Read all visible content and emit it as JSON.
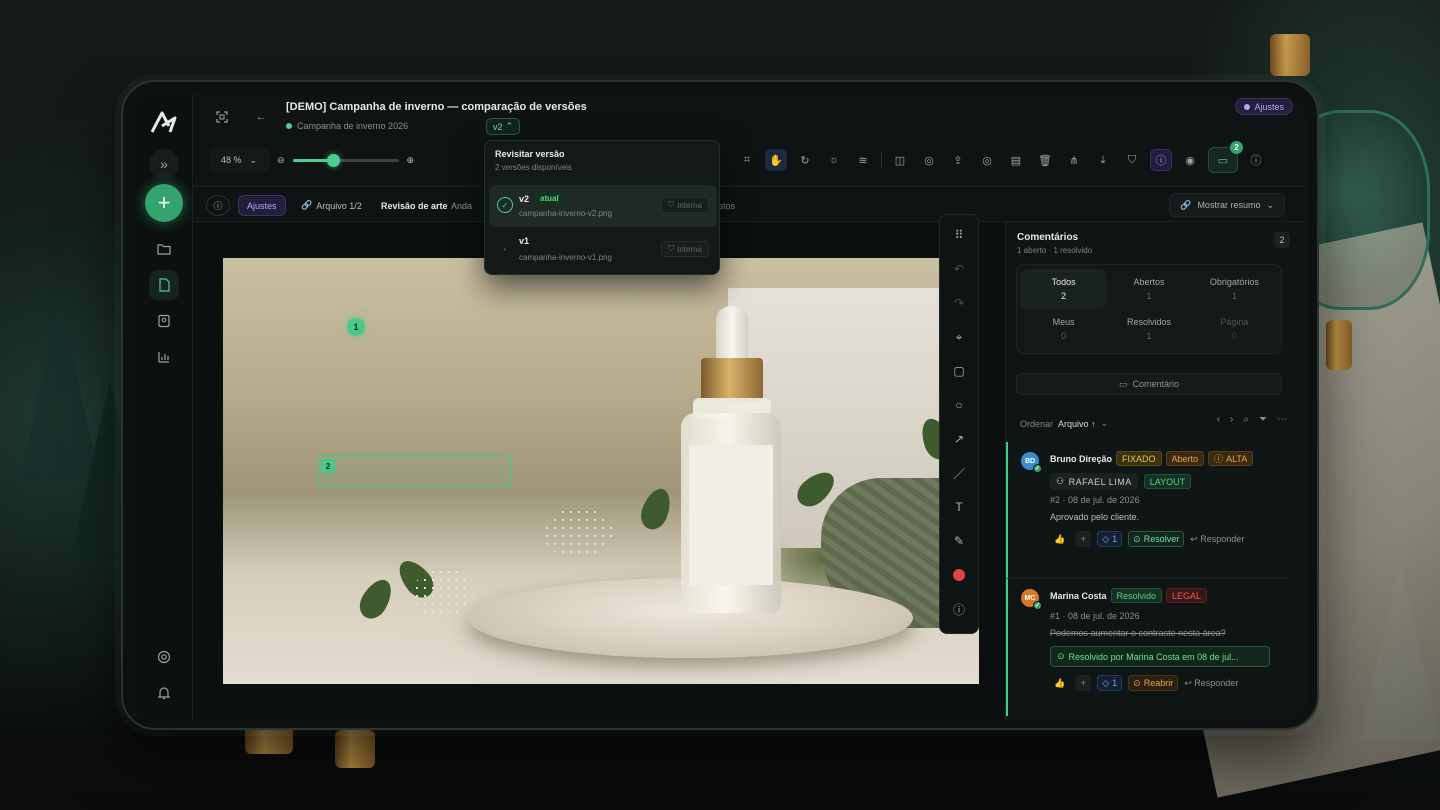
{
  "header": {
    "title": "[DEMO] Campanha de inverno — comparação de versões",
    "project": "Campanha de inverno 2026",
    "version_chip": "v2",
    "status_pill": "Ajustes"
  },
  "toolbar": {
    "zoom": "48 %",
    "zoom_fraction": 0.38,
    "comments_badge": "2"
  },
  "subbar": {
    "chip_ajustes": "Ajustes",
    "file": "Arquivo 1/2",
    "stage": "Revisão de arte",
    "stage_status": "Anda",
    "hidden_tail": "vistos",
    "summary_button": "Mostrar resumo"
  },
  "version_dropdown": {
    "title": "Revisitar versão",
    "subtitle": "2 versões disponíveis",
    "items": [
      {
        "version": "v2",
        "current": "atual",
        "file": "campanha-inverno-v2.png",
        "visibility": "Interna"
      },
      {
        "version": "v1",
        "current": "",
        "file": "campanha-inverno-v1.png",
        "visibility": "Interna"
      }
    ]
  },
  "canvas": {
    "pin1": "1",
    "pin2": "2"
  },
  "comments_panel": {
    "title": "Comentários",
    "summary": "1 aberto · 1 resolvido",
    "count": "2",
    "filters": [
      {
        "label": "Todos",
        "count": "2"
      },
      {
        "label": "Abertos",
        "count": "1"
      },
      {
        "label": "Obrigatórios",
        "count": "1"
      },
      {
        "label": "Meus",
        "count": "0"
      },
      {
        "label": "Resolvidos",
        "count": "1"
      },
      {
        "label": "Página",
        "count": "0"
      }
    ],
    "add_button": "Comentário",
    "order_label": "Ordenar",
    "order_value": "Arquivo ↑"
  },
  "comments": [
    {
      "initials": "BD",
      "author": "Bruno Direção",
      "tags": [
        "FIXADO",
        "Aberto",
        "ALTA"
      ],
      "assignee": "RAFAEL LIMA",
      "category": "LAYOUT",
      "meta": "#2 · 08 de jul. de 2026",
      "text": "Aprovado pelo cliente.",
      "plus": "+",
      "tag_count": "1",
      "primary_action": "Resolver",
      "reply": "Responder",
      "avatar_color": "#3a8ccf"
    },
    {
      "initials": "MC",
      "author": "Marina Costa",
      "tags": [
        "Resolvido",
        "LEGAL"
      ],
      "meta": "#1 · 08 de jul. de 2026",
      "text": "Podemos aumentar o contraste nesta área?",
      "resolved_by": "Resolvido por Marina Costa em 08 de jul...",
      "plus": "+",
      "tag_count": "1",
      "primary_action": "Reabrir",
      "reply": "Responder",
      "avatar_color": "#d9772b"
    }
  ],
  "colors": {
    "accent": "#4ccf91",
    "violet": "#b6a6ff",
    "surface": "#0f1314"
  }
}
